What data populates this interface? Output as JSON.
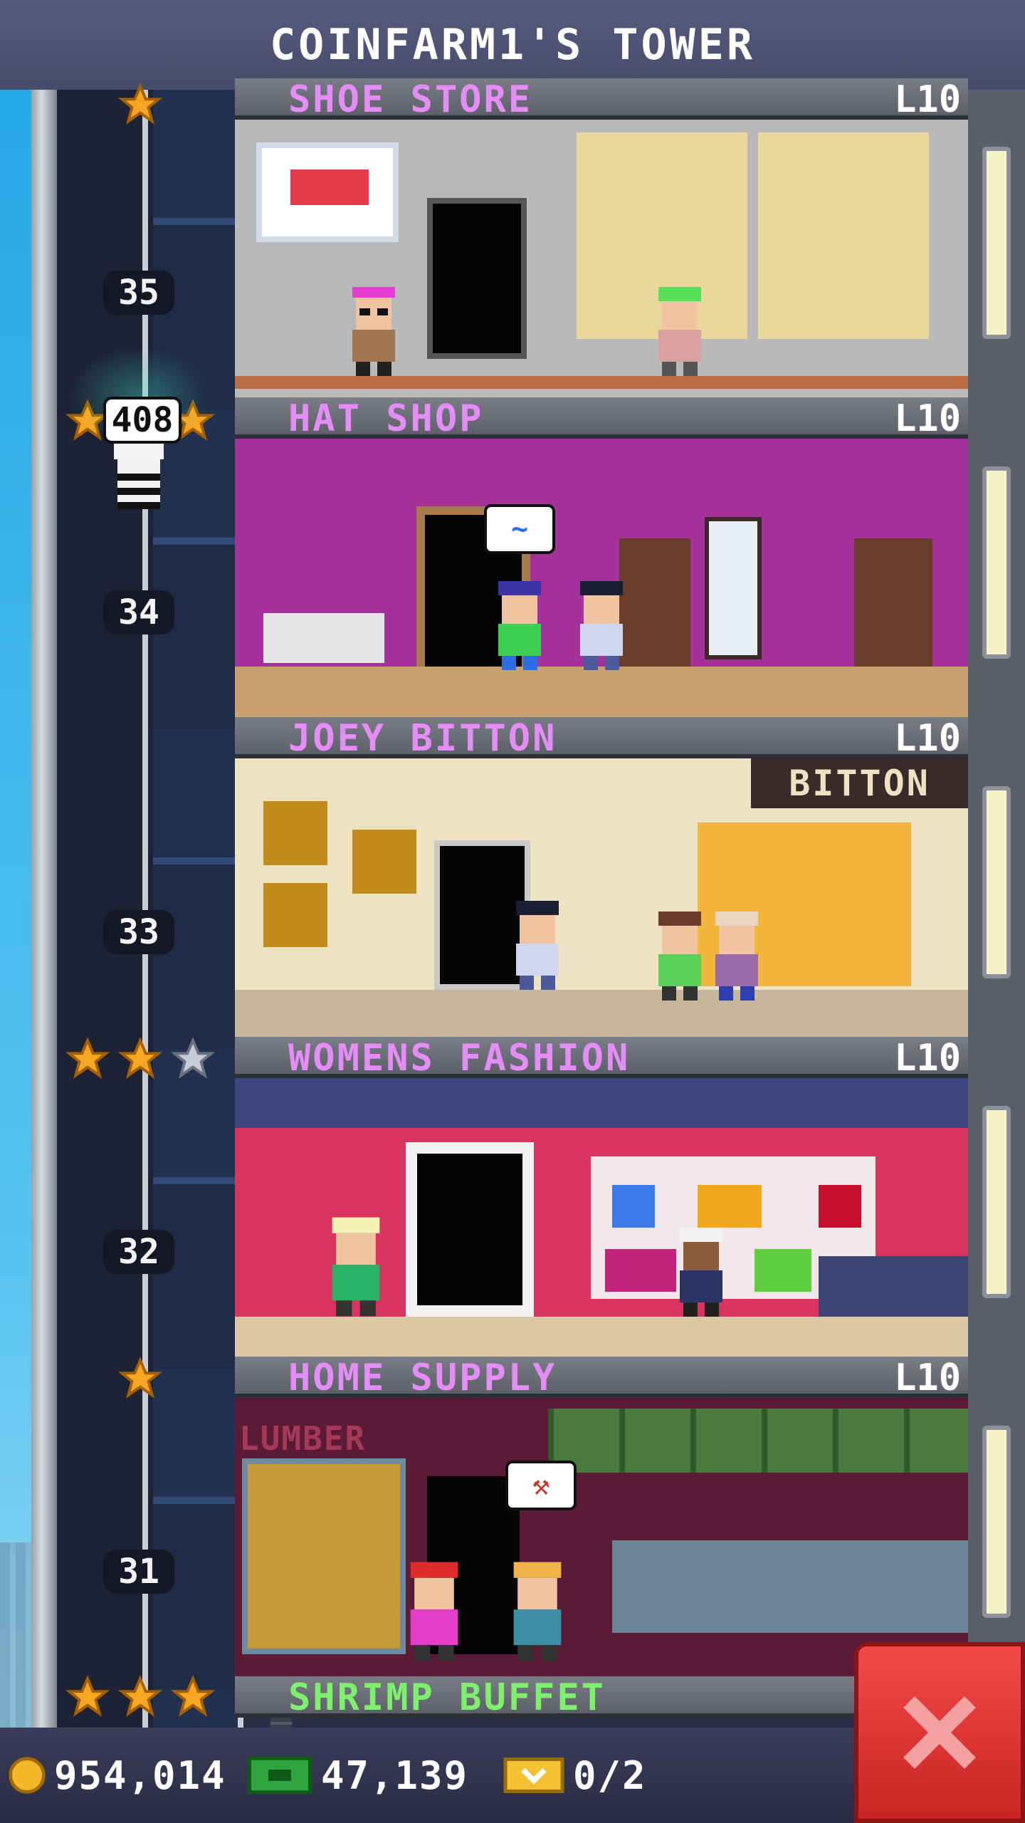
{
  "header": {
    "title": "COINFARM1'S TOWER"
  },
  "floors": [
    {
      "name": "SHOE STORE",
      "level": "L10",
      "name_color": "#e48df7"
    },
    {
      "name": "HAT SHOP",
      "level": "L10",
      "name_color": "#e48df7"
    },
    {
      "name": "JOEY BITTON",
      "level": "L10",
      "name_color": "#e48df7",
      "sign": "BITTON"
    },
    {
      "name": "WOMENS FASHION",
      "level": "L10",
      "name_color": "#e48df7"
    },
    {
      "name": "HOME SUPPLY",
      "level": "L10",
      "name_color": "#e48df7",
      "sign": "LUMBER"
    },
    {
      "name": "SHRIMP BUFFET",
      "level": "",
      "name_color": "#7ff06e"
    }
  ],
  "floor_numbers": [
    "35",
    "34",
    "33",
    "32",
    "31"
  ],
  "elevator": {
    "passenger_count": "408"
  },
  "stats": {
    "coins": "954,014",
    "bux": "47,139",
    "tickets": "0/2"
  },
  "colors": {
    "star_gold": "#f5a623",
    "star_silver": "#c8cbd6",
    "close_red": "#e53b3b"
  }
}
